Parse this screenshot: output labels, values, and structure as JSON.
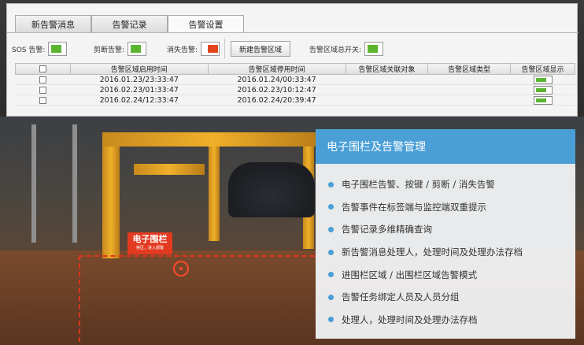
{
  "tabs": [
    {
      "label": "新告警消息"
    },
    {
      "label": "告警记录"
    },
    {
      "label": "告警设置",
      "active": true
    }
  ],
  "toolbar": {
    "sos_label": "SOS 告警:",
    "sos_state": "on",
    "cut_label": "剪断告警:",
    "cut_state": "on",
    "lost_label": "消失告警:",
    "lost_state": "off",
    "new_zone_button": "新建告警区域",
    "master_switch_label": "告警区域总开关:",
    "master_switch_state": "on"
  },
  "table": {
    "columns": [
      "告警区域启用时间",
      "告警区域停用时间",
      "告警区域关联对象",
      "告警区域类型",
      "告警区域显示"
    ],
    "rows": [
      {
        "start": "2016.01.23/23:33:47",
        "end": "2016.01.24/00:33:47",
        "object": "",
        "type": "",
        "display": "on"
      },
      {
        "start": "2016.02.23/01:33:47",
        "end": "2016.02.23/10:12:47",
        "object": "",
        "type": "",
        "display": "on"
      },
      {
        "start": "2016.02.24/12:33:47",
        "end": "2016.02.24/20:39:47",
        "object": "",
        "type": "",
        "display": "on"
      }
    ]
  },
  "fence_tag": {
    "title": "电子围栏",
    "subtitle": "禁区，进入报警"
  },
  "card": {
    "title": "电子围栏及告警管理",
    "items": [
      "电子围栏告警、按键 / 剪断 / 消失告警",
      "告警事件在标签端与监控端双重提示",
      "告警记录多维精确查询",
      "新告警消息处理人，处理时间及处理办法存档",
      "进围栏区域 / 出围栏区域告警模式",
      "告警任务绑定人员及人员分组",
      "处理人，处理时间及处理办法存档"
    ]
  },
  "colors": {
    "accent_blue": "#4a9fd6",
    "toggle_green": "#5bb531",
    "toggle_red": "#e3461f",
    "fence_red": "#e33b21"
  }
}
